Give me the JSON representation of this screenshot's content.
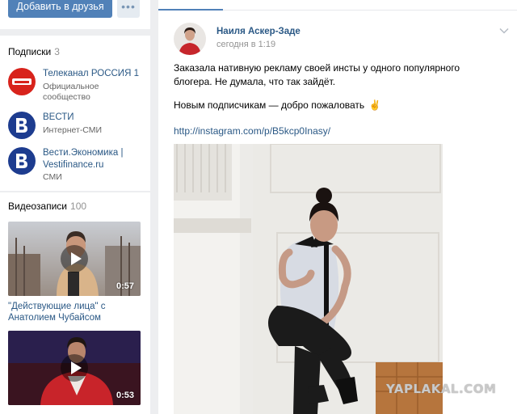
{
  "profile_actions": {
    "add_friend_label": "Добавить в друзья",
    "more_label": "•••"
  },
  "subscriptions": {
    "title": "Подписки",
    "count": "3",
    "items": [
      {
        "name": "Телеканал РОССИЯ 1",
        "desc": "Официальное сообщество",
        "avatar_color": "#d8231c",
        "avatar_text": "РОССИЯ 1"
      },
      {
        "name": "ВЕСТИ",
        "desc": "Интернет-СМИ",
        "avatar_color": "#1d3c8f",
        "avatar_text": "В"
      },
      {
        "name": "Вести.Экономика | Vestifinance.ru",
        "desc": "СМИ",
        "avatar_color": "#1d3c8f",
        "avatar_text": "В"
      }
    ]
  },
  "videos": {
    "title": "Видеозаписи",
    "count": "100",
    "items": [
      {
        "title": "\"Действующие лица\" с Анатолием Чубайсом",
        "duration": "0:57"
      },
      {
        "title": "",
        "duration": "0:53"
      }
    ]
  },
  "post": {
    "author": "Наиля Аскер-Заде",
    "date": "сегодня в 1:19",
    "text_line1": "Заказала нативную рекламу своей инсты у одного популярного блогера. Не думала, что так зайдёт.",
    "text_line2": "Новым подписчикам — добро пожаловать",
    "emoji": "✌",
    "link": "http://instagram.com/p/B5kcp0Inasy/"
  },
  "watermark": "YAPLAKAL.COM",
  "colors": {
    "accent": "#5181b8",
    "link": "#2a5885",
    "background": "#edeef0"
  }
}
